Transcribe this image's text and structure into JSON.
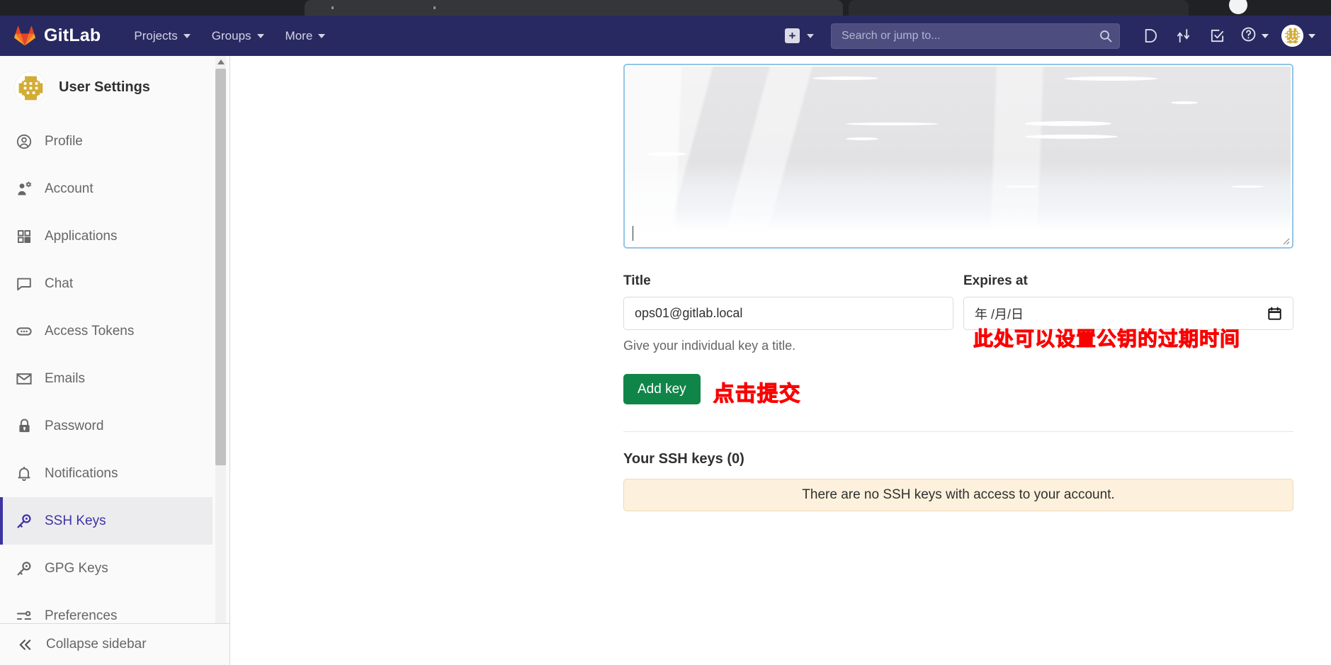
{
  "browser": {
    "tab_strip_present": true
  },
  "navbar": {
    "brand": "GitLab",
    "brand_icon": "gitlab-tanuki-logo",
    "links": [
      {
        "label": "Projects",
        "icon": "chevron-down-icon"
      },
      {
        "label": "Groups",
        "icon": "chevron-down-icon"
      },
      {
        "label": "More",
        "icon": "chevron-down-icon"
      }
    ],
    "new_menu": {
      "icon": "plus-square-icon",
      "caret": "chevron-down-icon"
    },
    "search": {
      "placeholder": "Search or jump to...",
      "value": "",
      "icon": "search-icon"
    },
    "icons": [
      {
        "name": "issues-icon"
      },
      {
        "name": "merge-requests-icon"
      },
      {
        "name": "todos-icon"
      },
      {
        "name": "help-icon"
      }
    ],
    "avatar_icon": "user-identicon-avatar"
  },
  "sidebar": {
    "title": "User Settings",
    "avatar_icon": "user-identicon-avatar",
    "items": [
      {
        "label": "Profile",
        "icon": "user-circle-icon",
        "active": false
      },
      {
        "label": "Account",
        "icon": "account-gear-icon",
        "active": false
      },
      {
        "label": "Applications",
        "icon": "applications-grid-icon",
        "active": false
      },
      {
        "label": "Chat",
        "icon": "chat-bubble-icon",
        "active": false
      },
      {
        "label": "Access Tokens",
        "icon": "token-icon",
        "active": false
      },
      {
        "label": "Emails",
        "icon": "envelope-icon",
        "active": false
      },
      {
        "label": "Password",
        "icon": "lock-icon",
        "active": false
      },
      {
        "label": "Notifications",
        "icon": "bell-icon",
        "active": false
      },
      {
        "label": "SSH Keys",
        "icon": "key-icon",
        "active": true
      },
      {
        "label": "GPG Keys",
        "icon": "key-icon",
        "active": false
      },
      {
        "label": "Preferences",
        "icon": "sliders-icon",
        "active": false
      }
    ],
    "collapse": {
      "label": "Collapse sidebar",
      "icon": "double-chevron-left-icon"
    },
    "scrollbar": {
      "up_arrow_icon": "scroll-up-arrow-icon"
    }
  },
  "main": {
    "key_textarea": {
      "value": "",
      "redacted": true,
      "resize_grip_icon": "resize-grip-icon"
    },
    "title_field": {
      "label": "Title",
      "value": "ops01@gitlab.local",
      "hint": "Give your individual key a title."
    },
    "expires_field": {
      "label": "Expires at",
      "value": "",
      "placeholder": "年 /月/日",
      "picker_icon": "calendar-icon"
    },
    "submit": {
      "label": "Add key"
    },
    "annotations": {
      "expires": "此处可以设置公钥的过期时间",
      "submit": "点击提交",
      "color": "#fa0000"
    },
    "keys_list": {
      "heading": "Your SSH keys (0)",
      "empty_message": "There are no SSH keys with access to your account."
    }
  },
  "colors": {
    "navbar_bg": "#292961",
    "accent_indigo": "#3c34a3",
    "success_green": "#108548",
    "alert_bg": "#fdf1dd",
    "focus_border": "#93c5e8"
  }
}
